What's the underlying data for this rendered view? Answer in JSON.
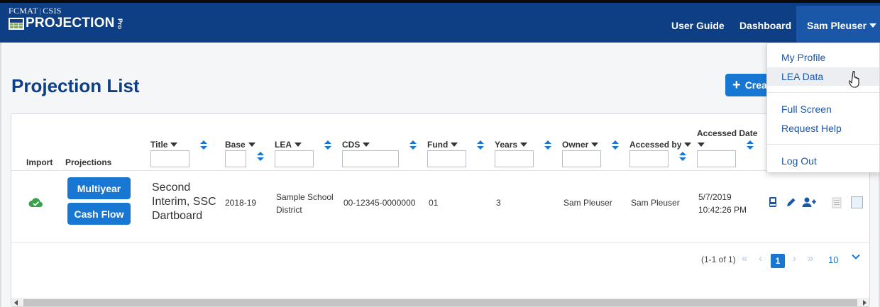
{
  "brand": {
    "org_left": "FCMAT",
    "org_sep": "|",
    "org_right": "CSIS",
    "product": "PROJECTION",
    "product_suffix": "Pro"
  },
  "nav": {
    "user_guide": "User Guide",
    "dashboard": "Dashboard",
    "user": "Sam Pleuser"
  },
  "page": {
    "title": "Projection List",
    "create_label": "Crea"
  },
  "table": {
    "headers": {
      "import": "Import",
      "projections": "Projections",
      "title": "Title",
      "base": "Base",
      "lea": "LEA",
      "cds": "CDS",
      "fund": "Fund",
      "years": "Years",
      "owner": "Owner",
      "accessed_by": "Accessed by",
      "accessed_date": "Accessed Date"
    },
    "rows": [
      {
        "multiyear": "Multiyear",
        "cash_flow": "Cash Flow",
        "title_lines": [
          "Second",
          "Interim, SSC",
          "Dartboard"
        ],
        "base": "2018-19",
        "lea_lines": [
          "Sample School",
          "District"
        ],
        "cds": "00-12345-0000000",
        "fund": "01",
        "years": "3",
        "owner": "Sam Pleuser",
        "accessed_by": "Sam Pleuser",
        "accessed_date_lines": [
          "5/7/2019",
          "10:42:26 PM"
        ]
      }
    ]
  },
  "pager": {
    "info": "(1-1 of 1)",
    "first": "«",
    "prev": "‹",
    "current_page": "1",
    "next": "›",
    "last": "»",
    "page_size": "10"
  },
  "dropdown": {
    "items": [
      "My Profile",
      "LEA Data",
      "Full Screen",
      "Request Help",
      "Log Out"
    ],
    "hovered": "LEA Data"
  },
  "colors": {
    "header_bg": "#0e3f85",
    "accent": "#1877d2",
    "import_icon": "#3aa04a"
  },
  "icons": [
    "cloud-check-icon",
    "book-icon",
    "pencil-icon",
    "user-plus-icon",
    "document-icon",
    "checkbox-icon",
    "filter-icon",
    "sort-icon",
    "caret-down-icon",
    "pointer-cursor-icon"
  ]
}
